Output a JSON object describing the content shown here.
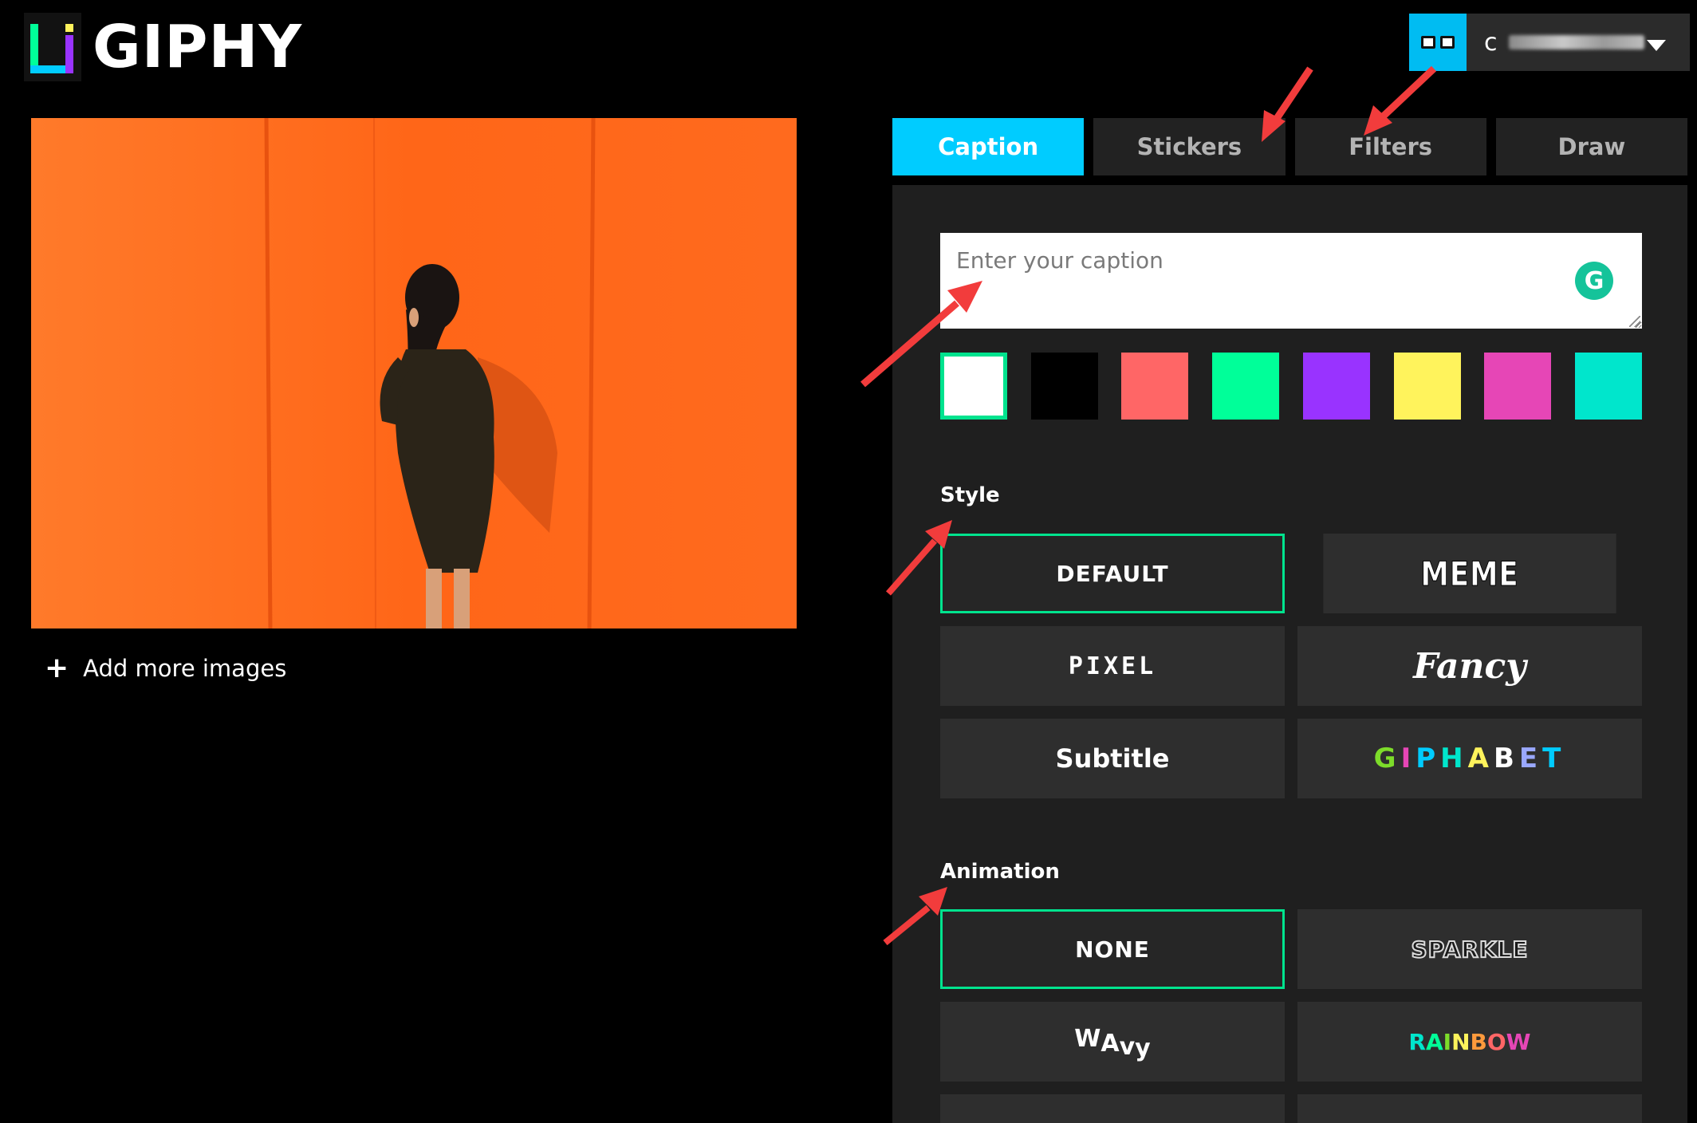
{
  "brand": {
    "name": "GIPHY"
  },
  "user": {
    "initial": "c"
  },
  "preview": {
    "add_more_label": "Add more images"
  },
  "tabs": [
    {
      "label": "Caption"
    },
    {
      "label": "Stickers"
    },
    {
      "label": "Filters"
    },
    {
      "label": "Draw"
    }
  ],
  "caption": {
    "placeholder": "Enter your caption"
  },
  "colors": [
    {
      "name": "white",
      "hex": "#ffffff"
    },
    {
      "name": "black",
      "hex": "#000000"
    },
    {
      "name": "coral",
      "hex": "#ff6666"
    },
    {
      "name": "green",
      "hex": "#00ff99"
    },
    {
      "name": "purple",
      "hex": "#9933ff"
    },
    {
      "name": "yellow",
      "hex": "#fff35c"
    },
    {
      "name": "magenta",
      "hex": "#e646b6"
    },
    {
      "name": "teal",
      "hex": "#00e6cc"
    }
  ],
  "style": {
    "label": "Style",
    "options": [
      "DEFAULT",
      "MEME",
      "PIXEL",
      "Fancy",
      "Subtitle",
      "GIPHABET"
    ]
  },
  "animation": {
    "label": "Animation",
    "options": [
      "NONE",
      "SPARKLE",
      "WAvy",
      "RAINBOW"
    ]
  }
}
